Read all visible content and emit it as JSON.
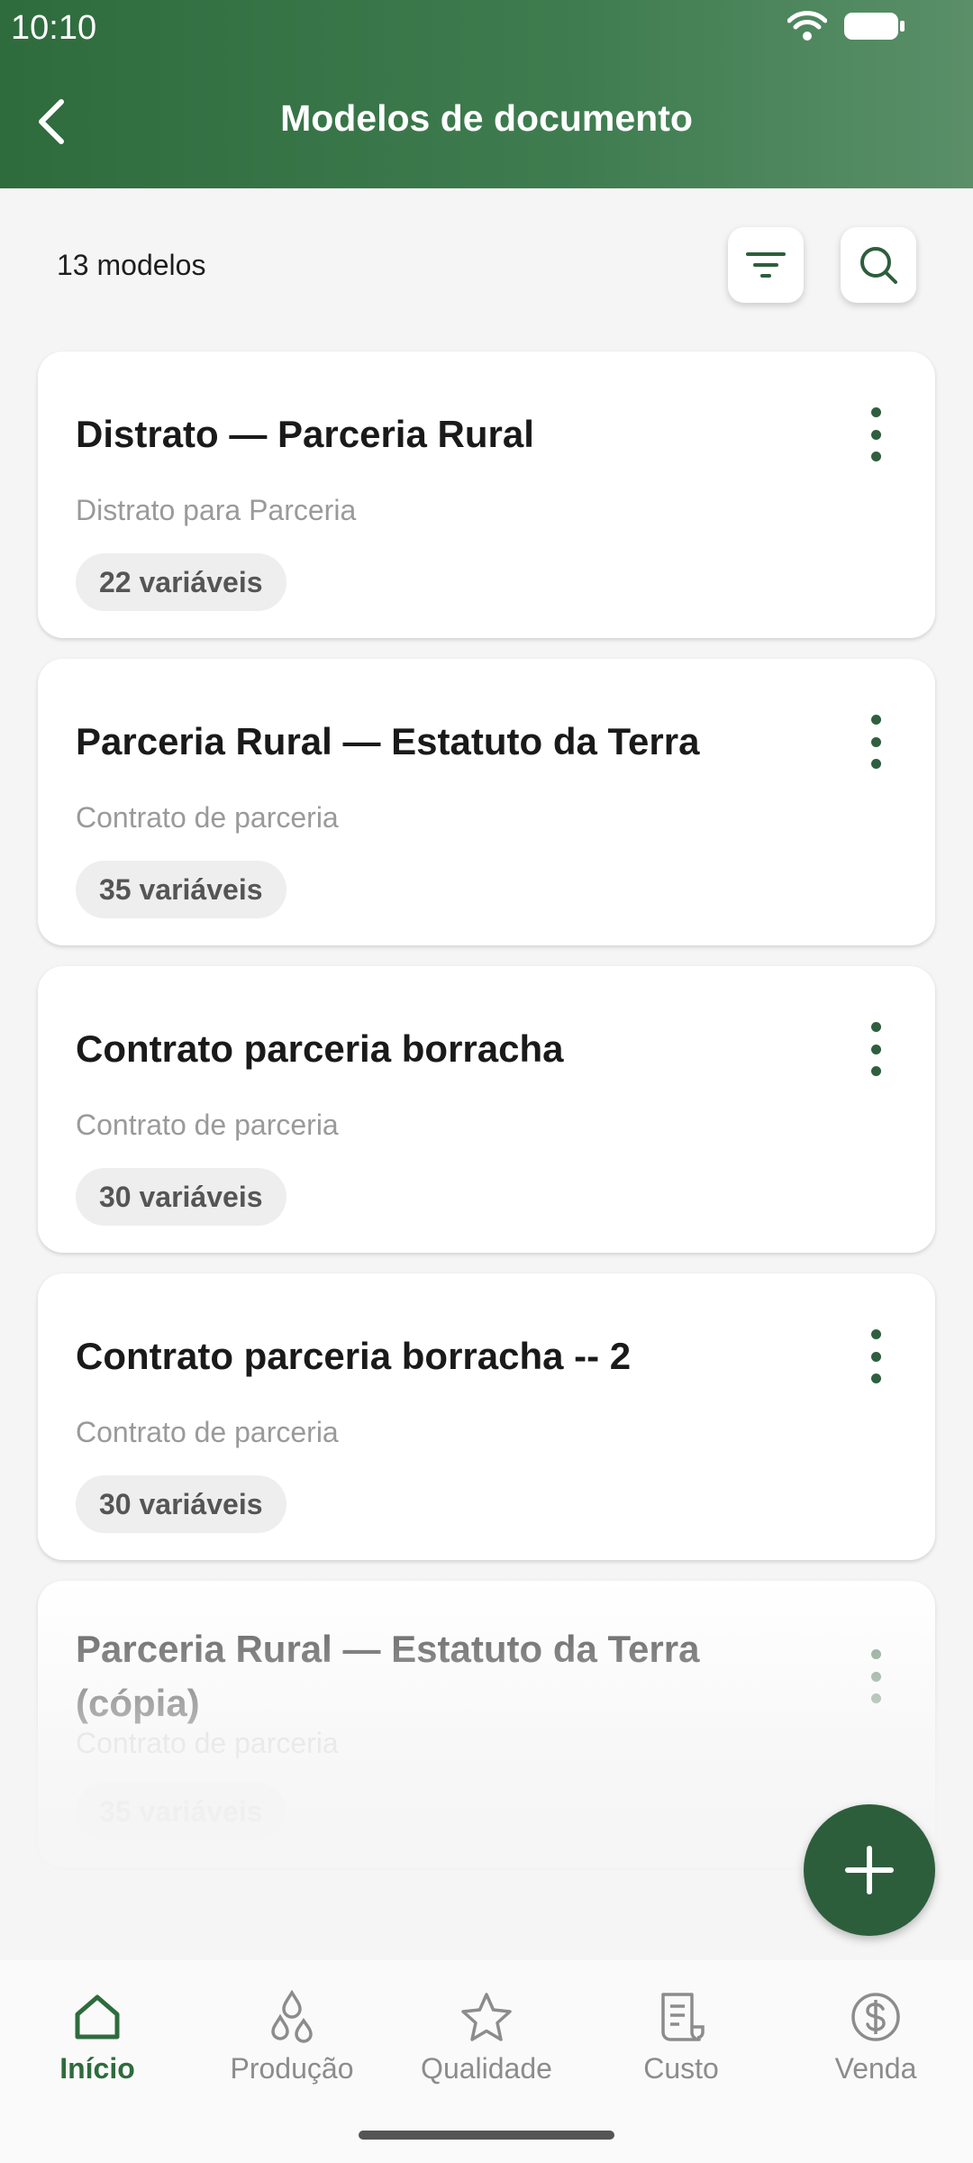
{
  "status_bar": {
    "time": "10:10"
  },
  "header": {
    "title": "Modelos de documento"
  },
  "toolbar": {
    "count_label": "13 modelos"
  },
  "cards": [
    {
      "title": "Distrato — Parceria Rural",
      "subtitle": "Distrato para Parceria",
      "badge": "22 variáveis"
    },
    {
      "title": "Parceria Rural — Estatuto da Terra",
      "subtitle": "Contrato de parceria",
      "badge": "35 variáveis"
    },
    {
      "title": "Contrato parceria borracha",
      "subtitle": "Contrato de parceria",
      "badge": "30 variáveis"
    },
    {
      "title": "Contrato parceria borracha -- 2",
      "subtitle": "Contrato de parceria",
      "badge": "30 variáveis"
    },
    {
      "title": "Parceria Rural — Estatuto da Terra (cópia)",
      "subtitle": "Contrato de parceria",
      "badge": "35 variáveis"
    }
  ],
  "bottom_nav": {
    "items": [
      {
        "label": "Início",
        "icon": "home-icon",
        "active": true
      },
      {
        "label": "Produção",
        "icon": "drops-icon"
      },
      {
        "label": "Qualidade",
        "icon": "star-icon"
      },
      {
        "label": "Custo",
        "icon": "receipt-icon"
      },
      {
        "label": "Venda",
        "icon": "dollar-circle-icon"
      }
    ]
  },
  "colors": {
    "primary": "#2e6b3d",
    "fab": "#2d5e3c"
  }
}
